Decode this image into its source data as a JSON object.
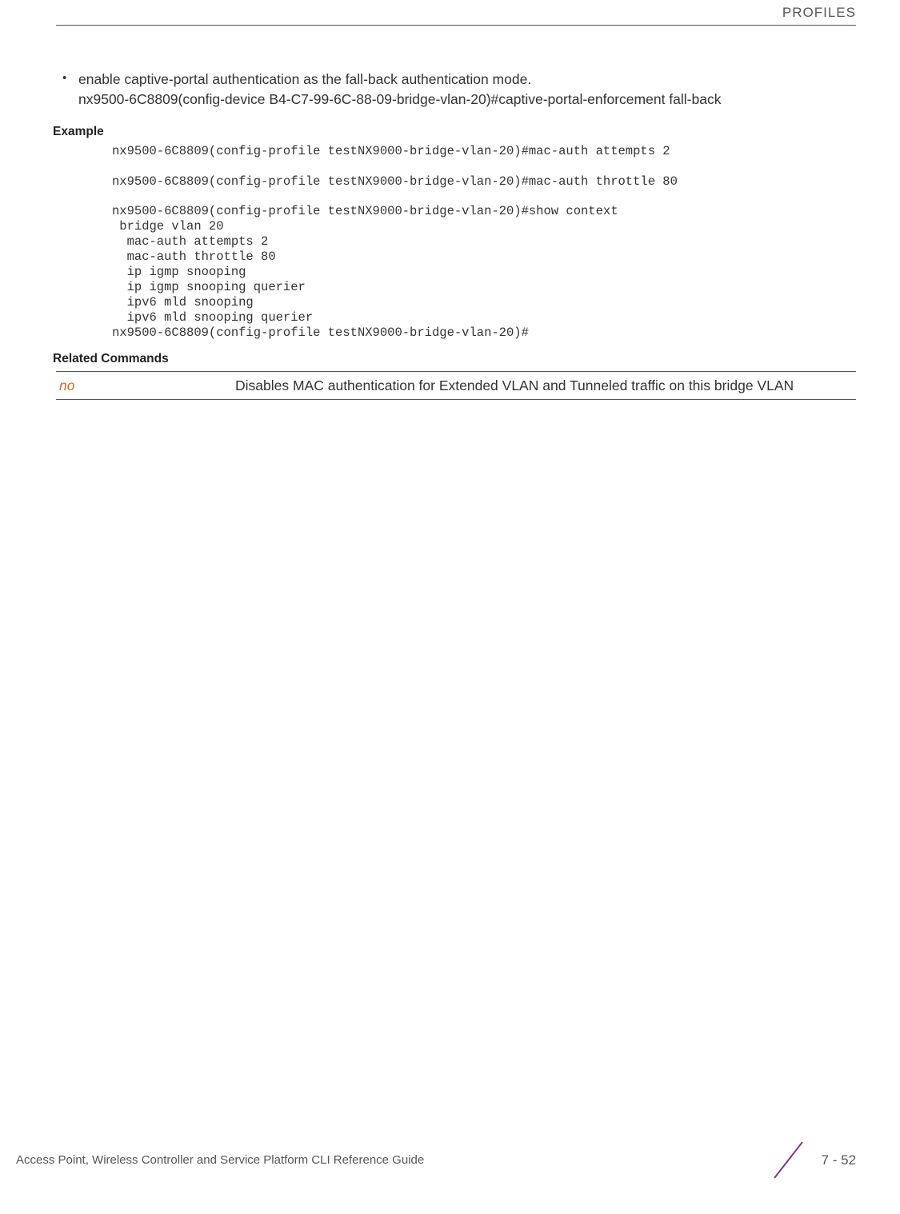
{
  "header": {
    "section": "PROFILES"
  },
  "bullet": {
    "marker": "•",
    "line1": "enable captive-portal authentication as the fall-back authentication mode.",
    "line2": "nx9500-6C8809(config-device B4-C7-99-6C-88-09-bridge-vlan-20)#captive-portal-enforcement fall-back"
  },
  "example": {
    "heading": "Example",
    "code": "nx9500-6C8809(config-profile testNX9000-bridge-vlan-20)#mac-auth attempts 2\n\nnx9500-6C8809(config-profile testNX9000-bridge-vlan-20)#mac-auth throttle 80\n\nnx9500-6C8809(config-profile testNX9000-bridge-vlan-20)#show context\n bridge vlan 20\n  mac-auth attempts 2\n  mac-auth throttle 80\n  ip igmp snooping\n  ip igmp snooping querier\n  ipv6 mld snooping\n  ipv6 mld snooping querier\nnx9500-6C8809(config-profile testNX9000-bridge-vlan-20)#"
  },
  "related": {
    "heading": "Related Commands",
    "rows": [
      {
        "cmd": "no",
        "desc": "Disables MAC authentication for Extended VLAN and Tunneled traffic on this bridge VLAN"
      }
    ]
  },
  "footer": {
    "text": "Access Point, Wireless Controller and Service Platform CLI Reference Guide",
    "page": "7 - 52"
  }
}
